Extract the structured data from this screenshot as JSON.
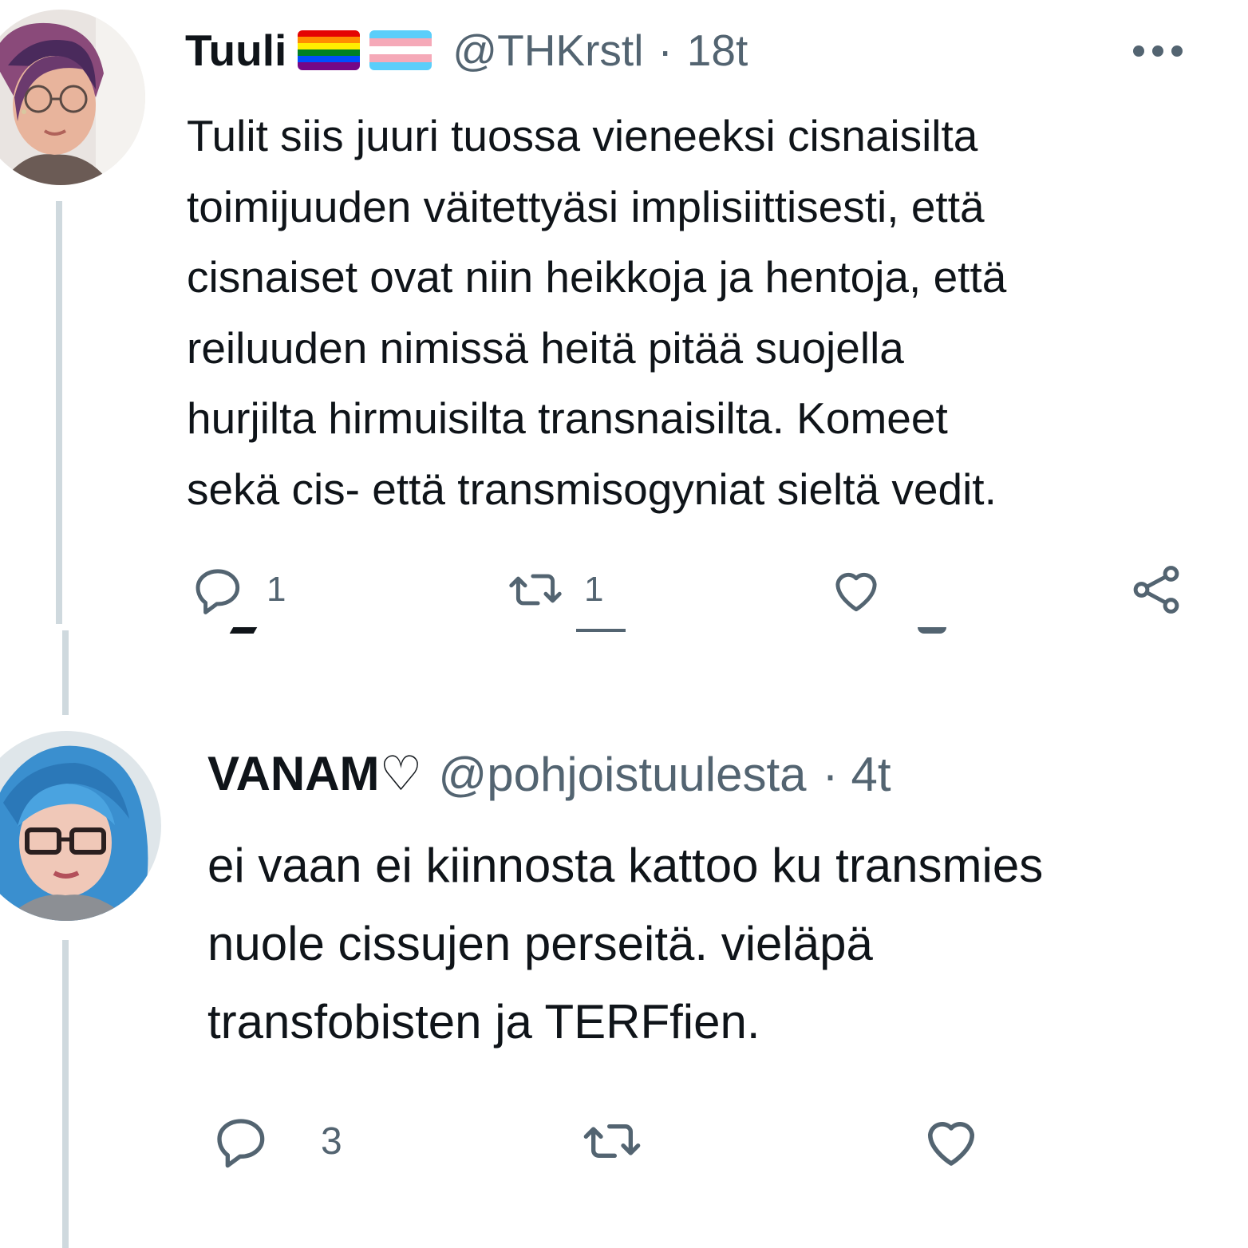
{
  "tweets": [
    {
      "display_name": "Tuuli",
      "flags": [
        "rainbow-flag-icon",
        "transgender-flag-icon"
      ],
      "handle": "@THKrstl",
      "separator": "·",
      "time": "18t",
      "text": "Tulit siis juuri tuossa vieneeksi cisnaisilta\ntoimijuuden väitettyäsi implisiittisesti, että\ncisnaiset ovat niin heikkoja ja hentoja, että\nreiluuden nimissä heitä pitää suojella\nhurjilta hirmuisilta transnaisilta. Komeet\nsekä cis- että transmisogyniat sieltä vedit.",
      "actions": {
        "reply_count": "1",
        "retweet_count": "1",
        "like_count": ""
      }
    },
    {
      "display_name": "VANAM♡",
      "handle": "@pohjoistuulesta",
      "separator": "·",
      "time": "4t",
      "text": "ei vaan ei kiinnosta kattoo ku transmies\nnuole cissujen perseitä. vieläpä\ntransfobisten ja TERFfien.",
      "actions": {
        "reply_count": "3",
        "retweet_count": "",
        "like_count": ""
      }
    }
  ],
  "colors": {
    "text": "#0f1419",
    "secondary": "#536471",
    "thread_line": "#cfd9de"
  },
  "icons": {
    "more": "more-horizontal-icon",
    "reply": "reply-icon",
    "retweet": "retweet-icon",
    "like": "heart-icon",
    "share": "share-icon"
  }
}
